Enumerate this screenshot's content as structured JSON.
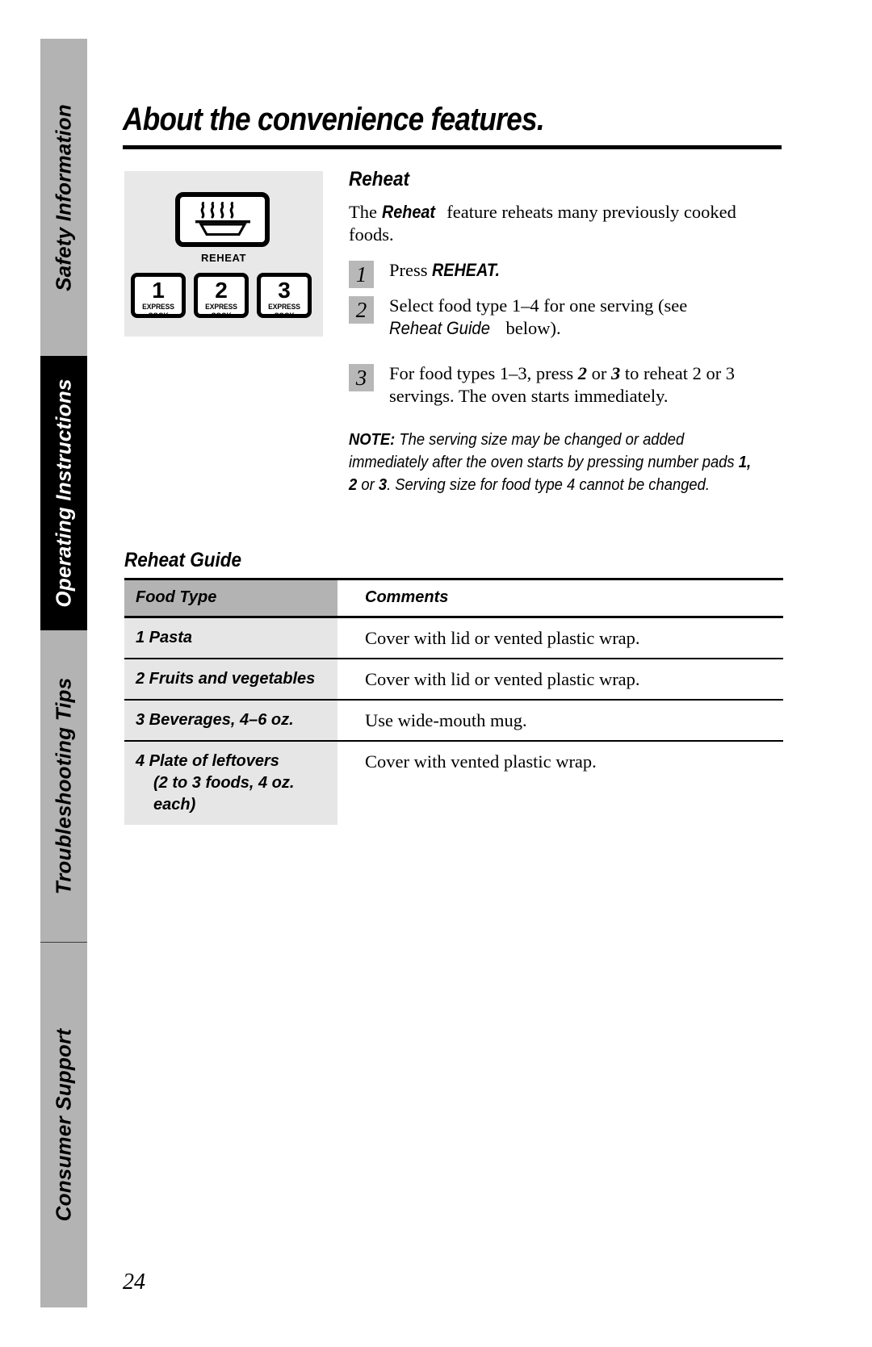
{
  "sidebar": {
    "tabs": [
      {
        "label": "Safety Information",
        "style": "gray"
      },
      {
        "label": "Operating Instructions",
        "style": "black"
      },
      {
        "label": "Troubleshooting Tips",
        "style": "gray"
      },
      {
        "label": "Consumer Support",
        "style": "gray"
      }
    ]
  },
  "header": {
    "title": "About the convenience features."
  },
  "illustration": {
    "reheat_key_label": "REHEAT",
    "reheat_icon": "steaming-dish-icon",
    "express_keys": [
      {
        "number": "1",
        "sub": "EXPRESS COOK"
      },
      {
        "number": "2",
        "sub": "EXPRESS COOK"
      },
      {
        "number": "3",
        "sub": "EXPRESS COOK"
      }
    ]
  },
  "reheat": {
    "heading": "Reheat",
    "intro_pre": "The ",
    "intro_bold": "Reheat",
    "intro_post": " feature reheats many previously cooked foods.",
    "steps": [
      {
        "num": "1",
        "pre": "Press ",
        "bold": "REHEAT.",
        "post": ""
      },
      {
        "num": "2",
        "pre": "Select food type 1–4 for one serving (see ",
        "italic": "Reheat Guide",
        "post": " below)."
      },
      {
        "num": "3",
        "pre": "For food types 1–3, press ",
        "bold_a": "2",
        "mid": " or ",
        "bold_b": "3",
        "post": " to reheat 2 or 3 servings. The oven starts immediately."
      }
    ],
    "note": {
      "label": "NOTE:",
      "text_1": " The serving size may be changed or added immediately after the oven starts by pressing number pads ",
      "bold_1": "1, 2",
      "text_2": " or ",
      "bold_2": "3",
      "text_3": ". Serving size for food type 4 cannot be changed."
    }
  },
  "guide": {
    "title": "Reheat Guide",
    "columns": [
      "Food Type",
      "Comments"
    ],
    "rows": [
      {
        "food": "1  Pasta",
        "food_sub": "",
        "comment": "Cover with lid or vented plastic wrap."
      },
      {
        "food": "2  Fruits and vegetables",
        "food_sub": "",
        "comment": "Cover with lid or vented plastic wrap."
      },
      {
        "food": "3  Beverages, 4–6 oz.",
        "food_sub": "",
        "comment": "Use wide-mouth mug."
      },
      {
        "food": "4  Plate of leftovers",
        "food_sub": "(2 to 3 foods, 4 oz. each)",
        "comment": "Cover with vented plastic wrap."
      }
    ]
  },
  "footer": {
    "page_number": "24"
  },
  "colors": {
    "sidebar_gray": "#b3b3b3",
    "sidebar_black": "#000000",
    "panel_bg": "#e8e8e8",
    "table_header_gray": "#b3b3b3",
    "table_cell_gray": "#e6e6e6",
    "step_badge_gray": "#b8b8b8"
  }
}
